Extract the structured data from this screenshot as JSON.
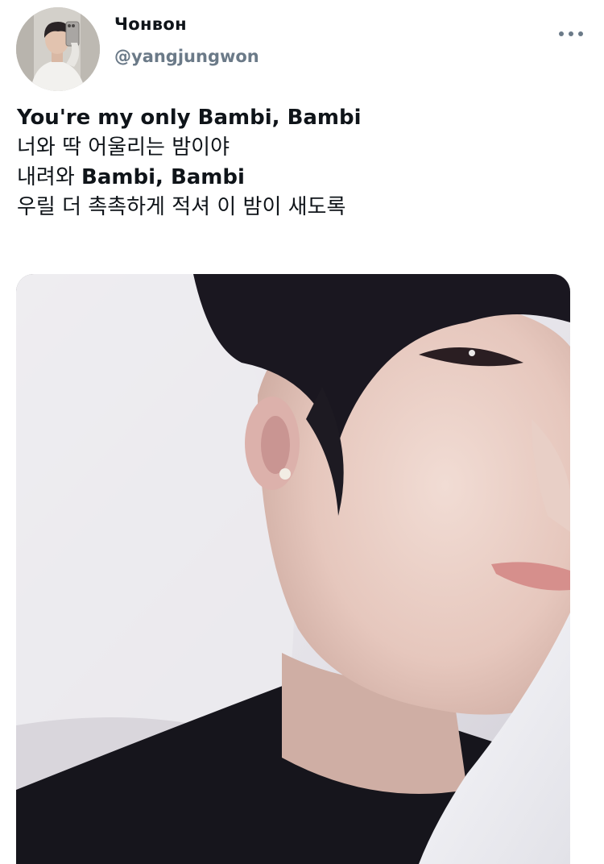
{
  "tweet": {
    "author_name": "Чонвон",
    "author_handle": "@yangjungwon",
    "more_icon": "more-horizontal-icon",
    "lines": [
      {
        "bold": "You're my only Bambi, Bambi",
        "plain": ""
      },
      {
        "bold": "",
        "plain": "너와 딱 어울리는 밤이야"
      },
      {
        "plain_prefix": "내려와 ",
        "bold": "Bambi, Bambi"
      },
      {
        "bold": "",
        "plain": "우릴 더 촉촉하게 적셔 이 밤이 새도록"
      }
    ],
    "media": {
      "type": "photo"
    }
  },
  "colors": {
    "text_primary": "#0f1419",
    "text_secondary": "#6b7a88",
    "background": "#ffffff"
  }
}
